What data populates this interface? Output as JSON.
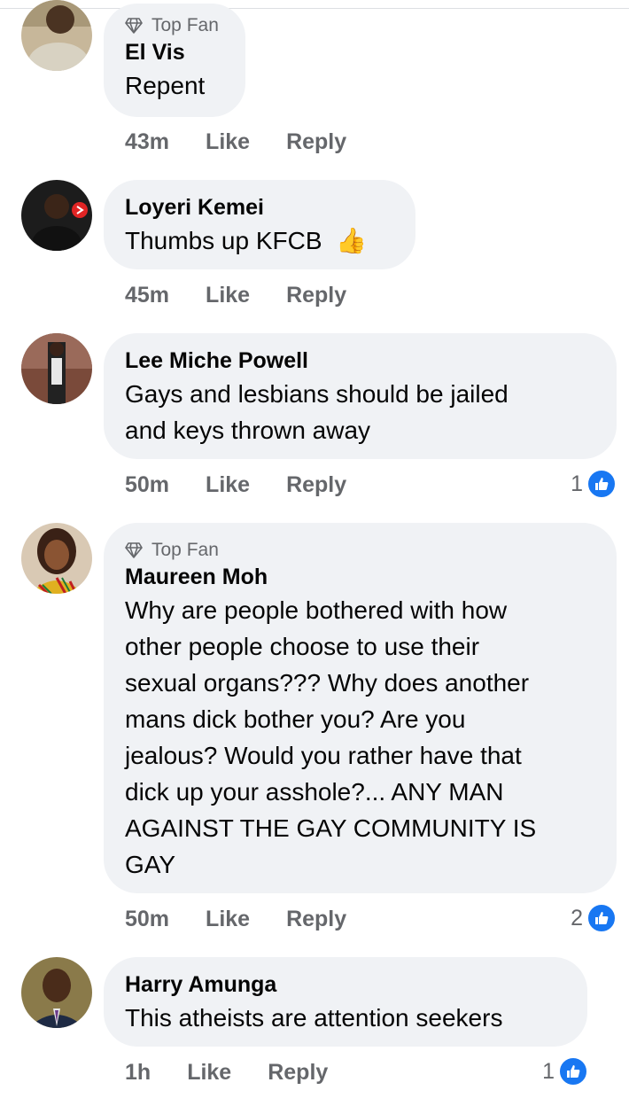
{
  "comments": [
    {
      "badge": "Top Fan",
      "name": "El Vis",
      "text": "Repent",
      "time": "43m",
      "like": "Like",
      "reply": "Reply",
      "reactions": ""
    },
    {
      "name": "Loyeri Kemei",
      "text": "Thumbs up KFCB",
      "emoji": "👍",
      "time": "45m",
      "like": "Like",
      "reply": "Reply",
      "reactions": ""
    },
    {
      "name": "Lee Miche Powell",
      "text_lines": [
        "Gays and lesbians should be jailed",
        "and keys thrown away"
      ],
      "time": "50m",
      "like": "Like",
      "reply": "Reply",
      "reactions": "1"
    },
    {
      "badge": "Top Fan",
      "name": "Maureen Moh",
      "text_lines": [
        "Why are people bothered with how",
        "other people choose to use their",
        "sexual organs??? Why does another",
        "mans dick bother you? Are you",
        "jealous? Would you rather have that",
        "dick up your asshole?... ANY MAN",
        "AGAINST THE GAY COMMUNITY IS",
        "GAY"
      ],
      "time": "50m",
      "like": "Like",
      "reply": "Reply",
      "reactions": "2"
    },
    {
      "name": "Harry Amunga",
      "text": "This atheists are attention seekers",
      "time": "1h",
      "like": "Like",
      "reply": "Reply",
      "reactions": "1"
    }
  ],
  "icons": {
    "badge": "diamond-icon",
    "reaction": "like-thumb-icon"
  },
  "colors": {
    "bubble": "#f0f2f5",
    "meta_text": "#65676b",
    "like_blue": "#1877f2"
  }
}
